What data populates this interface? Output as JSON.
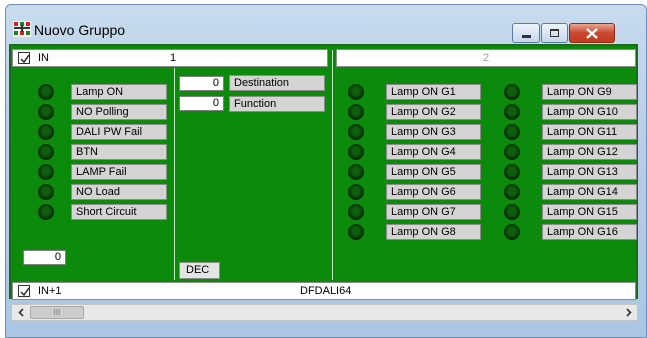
{
  "window": {
    "title": "Nuovo Gruppo",
    "icon": "network-module-icon"
  },
  "group1": {
    "label": "IN",
    "number": "1",
    "checked": true
  },
  "group2": {
    "number": "2"
  },
  "bottom_group": {
    "label": "IN+1",
    "device": "DFDALI64",
    "checked": true
  },
  "status_labels": [
    "Lamp ON",
    "NO Polling",
    "DALI PW Fail",
    "BTN",
    "LAMP Fail",
    "NO Load",
    "Short Circuit"
  ],
  "address_value": "0",
  "destination": {
    "value": "0",
    "label": "Destination"
  },
  "function": {
    "value": "0",
    "label": "Function"
  },
  "dec_label": "DEC",
  "groups_left": [
    "Lamp ON G1",
    "Lamp ON G2",
    "Lamp ON G3",
    "Lamp ON G4",
    "Lamp ON G5",
    "Lamp ON G6",
    "Lamp ON G7",
    "Lamp ON G8"
  ],
  "groups_right": [
    "Lamp ON G9",
    "Lamp ON G10",
    "Lamp ON G11",
    "Lamp ON G12",
    "Lamp ON G13",
    "Lamp ON G14",
    "Lamp ON G15",
    "Lamp ON G16"
  ],
  "scrollbar": {
    "thumb_grip": "III"
  },
  "colors": {
    "panel_green": "#0b8a0b",
    "led_off": "#0f5f0f",
    "label_bg": "#d4d4d4"
  }
}
